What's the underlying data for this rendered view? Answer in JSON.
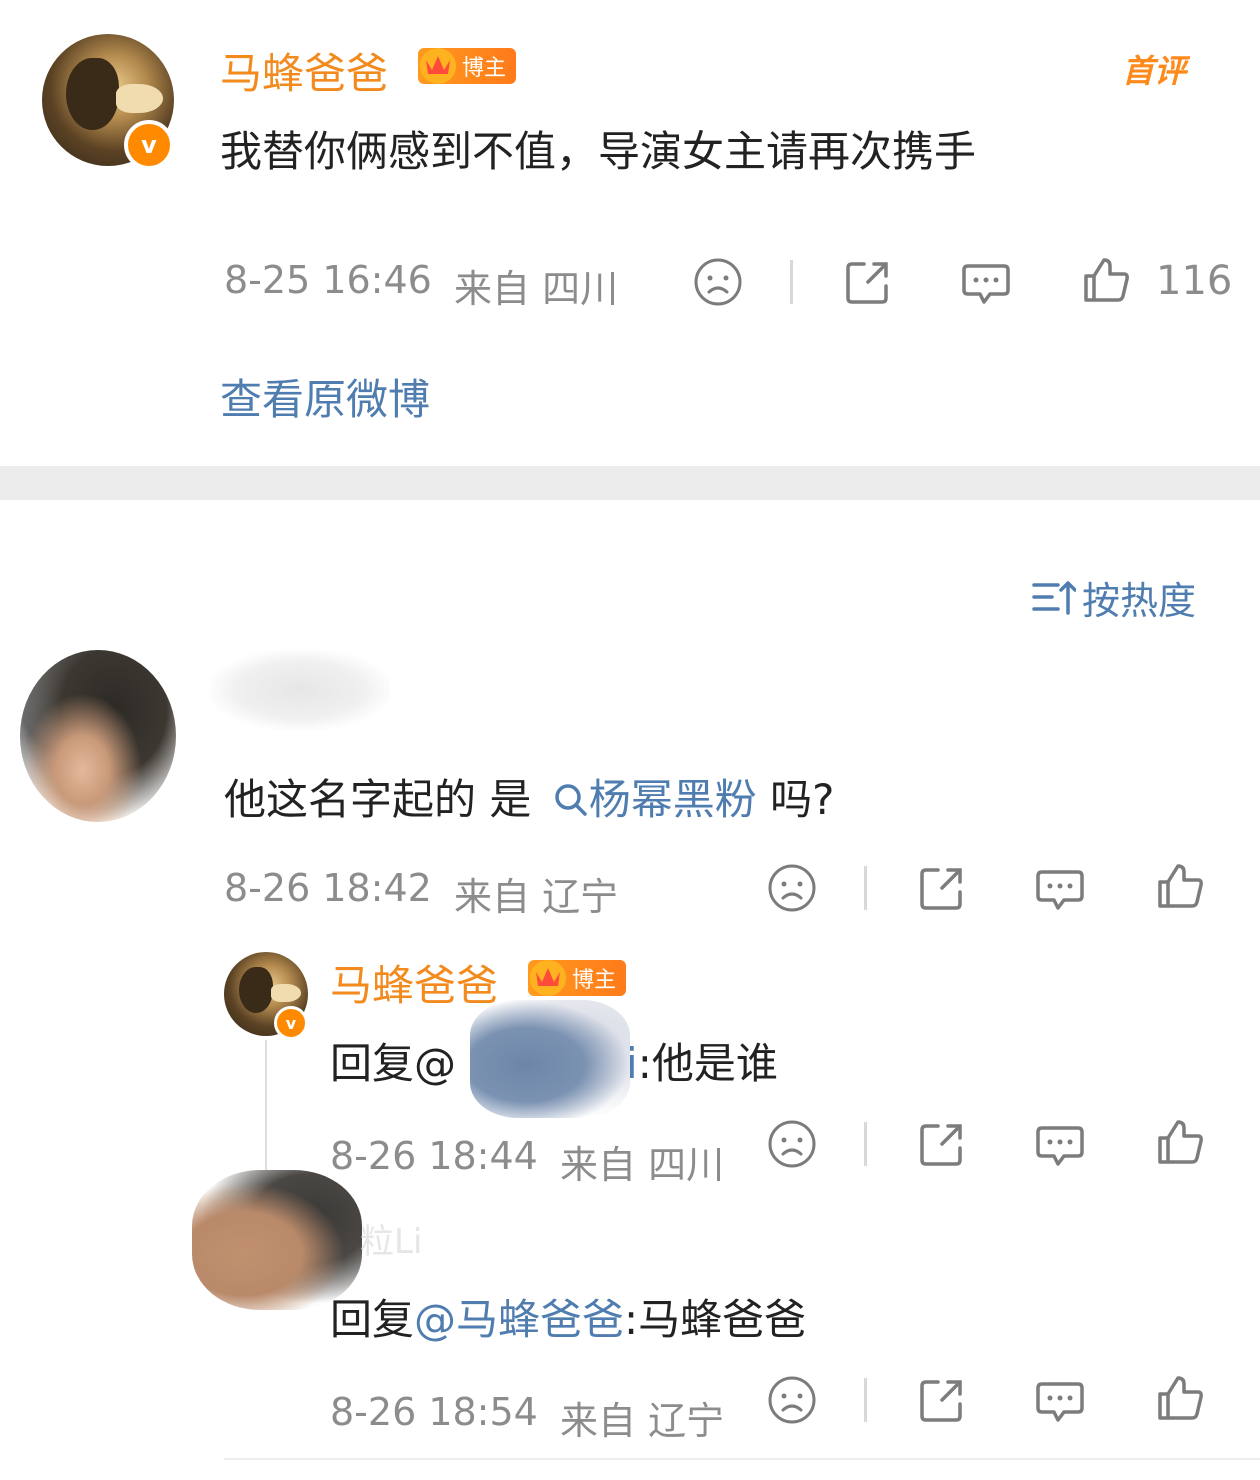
{
  "post": {
    "author": "马蜂爸爸",
    "badge": "博主",
    "tag": "首评",
    "text": "我替你俩感到不值，导演女主请再次携手",
    "time": "8-25 16:46",
    "location": "来自 四川",
    "like_count": "116",
    "view_original": "查看原微博"
  },
  "sort": {
    "label": "按热度"
  },
  "comment": {
    "text_before": "他这名字起的 是",
    "topic": "杨幂黑粉",
    "text_after": " 吗?",
    "time": "8-26 18:42",
    "location": "来自 辽宁"
  },
  "replies": [
    {
      "author": "马蜂爸爸",
      "badge": "博主",
      "prefix": "回复@",
      "mention_tail": "i",
      "text": ":他是谁",
      "time": "8-26 18:44",
      "location": "来自 四川"
    },
    {
      "author_partial": "粒Li",
      "prefix": "回复",
      "mention": "@马蜂爸爸",
      "text": ":马蜂爸爸",
      "time": "8-26 18:54",
      "location": "来自 辽宁"
    }
  ],
  "colors": {
    "name": "#f28a1e",
    "link": "#507daf",
    "meta": "#8c8c8c",
    "divider": "#ececec"
  },
  "icons": [
    "sad-face-icon",
    "share-icon",
    "comment-icon",
    "thumbs-up-icon",
    "sort-icon",
    "search-icon",
    "crown-icon",
    "verified-v-icon"
  ]
}
